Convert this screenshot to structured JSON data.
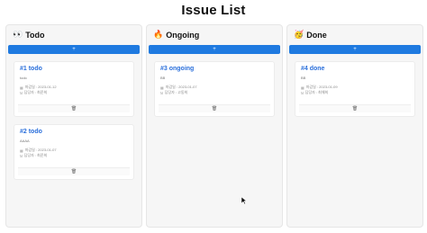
{
  "title": "Issue List",
  "columns": [
    {
      "emoji": "👀",
      "name": "Todo",
      "add_label": "+",
      "cards": [
        {
          "title": "#1 todo",
          "body": "todo",
          "date": "마감일 : 2023-01-12",
          "assignee": "담당자 : 최준희"
        },
        {
          "title": "#2 todo",
          "body": "AAAA",
          "date": "마감일 : 2023-01-07",
          "assignee": "담당자 : 최준희"
        }
      ]
    },
    {
      "emoji": "🔥",
      "name": "Ongoing",
      "add_label": "+",
      "cards": [
        {
          "title": "#3 ongoing",
          "body": "BB",
          "date": "마감일 : 2023-01-07",
          "assignee": "담당자 : 고동희"
        }
      ]
    },
    {
      "emoji": "🥳",
      "name": "Done",
      "add_label": "+",
      "cards": [
        {
          "title": "#4 done",
          "body": "BB",
          "date": "마감일 : 2023-01-09",
          "assignee": "담당자 : 최해희"
        }
      ]
    }
  ],
  "icons": {
    "calendar": "calendar-icon",
    "person": "person-icon",
    "trash": "trash-icon"
  },
  "colors": {
    "accent": "#1f7ae0",
    "card_title": "#2a6fdb"
  }
}
